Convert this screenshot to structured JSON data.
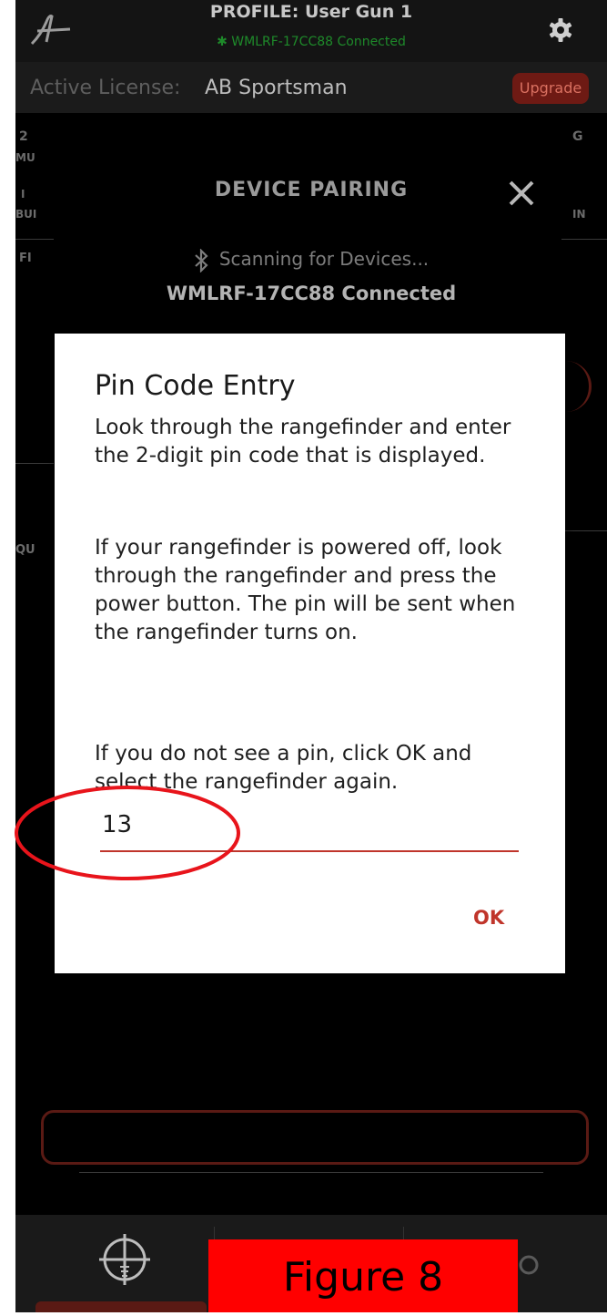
{
  "header": {
    "profile_title": "PROFILE: User Gun 1",
    "connection_status": "WMLRF-17CC88 Connected",
    "logo_icon": "logo-icon",
    "settings_icon": "gear-icon"
  },
  "license": {
    "label": "Active License:",
    "value": "AB Sportsman",
    "upgrade_label": "Upgrade"
  },
  "background_edges": {
    "left_top": "2",
    "left_sub": "MU",
    "left_mid": "I",
    "left_mid_sub": "BUI",
    "left_fi": "FI",
    "left_qu": "QU",
    "right_top": "G",
    "right_sub": "IN"
  },
  "device_pairing": {
    "title": "DEVICE PAIRING",
    "scanning_text": "Scanning for Devices...",
    "connected_text": "WMLRF-17CC88 Connected"
  },
  "dialog": {
    "title": "Pin Code Entry",
    "paragraph_1": "Look through the rangefinder and enter the 2-digit pin code that is displayed.",
    "paragraph_2": "If your rangefinder is powered off, look through the rangefinder and press the power button. The pin will be sent when the rangefinder turns on.",
    "paragraph_3": "If you do not see a pin, click OK and select the rangefinder again.",
    "pin_value": "13",
    "ok_label": "OK"
  },
  "figure_caption": "Figure 8",
  "colors": {
    "accent_red": "#c0352b",
    "connected_green": "#1e8a2a",
    "highlight_red": "#e8141b"
  }
}
